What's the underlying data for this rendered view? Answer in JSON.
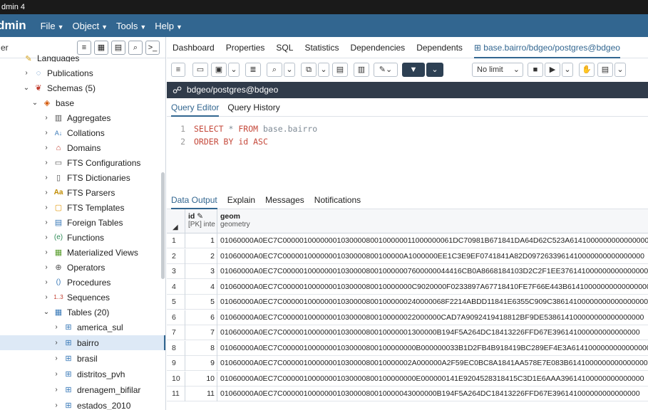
{
  "window": {
    "title": "dmin 4"
  },
  "menubar": {
    "brand": "dmin",
    "menus": [
      "File",
      "Object",
      "Tools",
      "Help"
    ]
  },
  "left_panel": {
    "header_label": "er",
    "tree": [
      {
        "label": "Languages",
        "icon": "language-icon"
      },
      {
        "label": "Publications",
        "icon": "publication-icon"
      },
      {
        "label": "Schemas (5)",
        "icon": "schemas-icon"
      },
      {
        "label": "base",
        "icon": "schema-icon"
      },
      {
        "label": "Aggregates",
        "icon": "aggregate-icon"
      },
      {
        "label": "Collations",
        "icon": "collation-icon"
      },
      {
        "label": "Domains",
        "icon": "domain-icon"
      },
      {
        "label": "FTS Configurations",
        "icon": "fts-config-icon"
      },
      {
        "label": "FTS Dictionaries",
        "icon": "fts-dict-icon"
      },
      {
        "label": "FTS Parsers",
        "icon": "fts-parser-icon"
      },
      {
        "label": "FTS Templates",
        "icon": "fts-template-icon"
      },
      {
        "label": "Foreign Tables",
        "icon": "foreign-table-icon"
      },
      {
        "label": "Functions",
        "icon": "function-icon"
      },
      {
        "label": "Materialized Views",
        "icon": "matview-icon"
      },
      {
        "label": "Operators",
        "icon": "operator-icon"
      },
      {
        "label": "Procedures",
        "icon": "procedure-icon"
      },
      {
        "label": "Sequences",
        "icon": "sequence-icon"
      },
      {
        "label": "Tables (20)",
        "icon": "tables-icon"
      },
      {
        "label": "america_sul",
        "icon": "table-icon"
      },
      {
        "label": "bairro",
        "icon": "table-icon"
      },
      {
        "label": "brasil",
        "icon": "table-icon"
      },
      {
        "label": "distritos_pvh",
        "icon": "table-icon"
      },
      {
        "label": "drenagem_bifilar",
        "icon": "table-icon"
      },
      {
        "label": "estados_2010",
        "icon": "table-icon"
      }
    ],
    "icon_glyphs": {
      "aa": "Aa",
      "sequence": "1..3",
      "function": "(e)",
      "procedure": "()",
      "collation": "A↓"
    }
  },
  "right_panel": {
    "tabs": [
      "Dashboard",
      "Properties",
      "SQL",
      "Statistics",
      "Dependencies",
      "Dependents",
      "base.bairro/bdgeo/postgres@bdgeo"
    ],
    "toolbar": {
      "limit": "No limit"
    },
    "connection": "bdgeo/postgres@bdgeo",
    "editor_tabs": [
      "Query Editor",
      "Query History"
    ],
    "sql": {
      "line1_num": "1",
      "line1_kw1": "SELECT",
      "line1_mid": "*",
      "line1_kw2": "FROM",
      "line1_tbl": "base.bairro",
      "line2_num": "2",
      "line2_kw": "ORDER BY",
      "line2_col": "id",
      "line2_dir": "ASC"
    },
    "output_tabs": [
      "Data Output",
      "Explain",
      "Messages",
      "Notifications"
    ],
    "grid": {
      "columns": [
        {
          "name": "id",
          "type": "[PK] inte"
        },
        {
          "name": "geom",
          "type": "geometry"
        }
      ],
      "rows": [
        {
          "n": "1",
          "id": "1",
          "geom": "01060000A0EC7C00000100000001030000800100000011000000061DC70981B671841DA64D62C523A61410000000000000000"
        },
        {
          "n": "2",
          "id": "2",
          "geom": "01060000A0EC7C00000100000001030000800100000A1000000EE1C3E9EF0741841A82D0972633961410000000000000000"
        },
        {
          "n": "3",
          "id": "3",
          "geom": "01060000A0EC7C0000010000000103000080010000007600000044416CB0A8668184103D2C2F1EE376141000000000000000"
        },
        {
          "n": "4",
          "id": "4",
          "geom": "01060000A0EC7C0000010000000103000080010000000C9020000F0233897A67718410FE7F66E443B614100000000000000000"
        },
        {
          "n": "5",
          "id": "5",
          "geom": "01060000A0EC7C000001000000010300008001000000240000068F2214ABDD11841E6355C909C38614100000000000000000"
        },
        {
          "n": "6",
          "id": "6",
          "geom": "01060000A0EC7C00000100000001030000800100000022000000CAD7A9092419418812BF9DE538614100000000000000000"
        },
        {
          "n": "7",
          "id": "7",
          "geom": "01060000A0EC7C0000010000000103000080010000001300000B194F5A264DC18413226FFD67E396141000000000000000"
        },
        {
          "n": "8",
          "id": "8",
          "geom": "01060000A0EC7C00000100000001030000800100000000B000000033B1D2FB4B918419BC289EF4E3A6141000000000000000"
        },
        {
          "n": "9",
          "id": "9",
          "geom": "01060000A0EC7C0000010000000103000080010000002A000000A2F59EC0BC8A1841AA578E7E083B6141000000000000000"
        },
        {
          "n": "10",
          "id": "10",
          "geom": "01060000A0EC7C00000100000001030000800100000000E000000141E9204528318415C3D1E6AAA39614100000000000000"
        },
        {
          "n": "11",
          "id": "11",
          "geom": "01060000A0EC7C0000010000000103000080010000043000000B194F5A264DC18413226FFD67E396141000000000000000"
        }
      ]
    }
  },
  "colors": {
    "brand": "#326690",
    "titlebar": "#1a1a1a",
    "connbar": "#303b4a",
    "keyword": "#c5493b"
  }
}
